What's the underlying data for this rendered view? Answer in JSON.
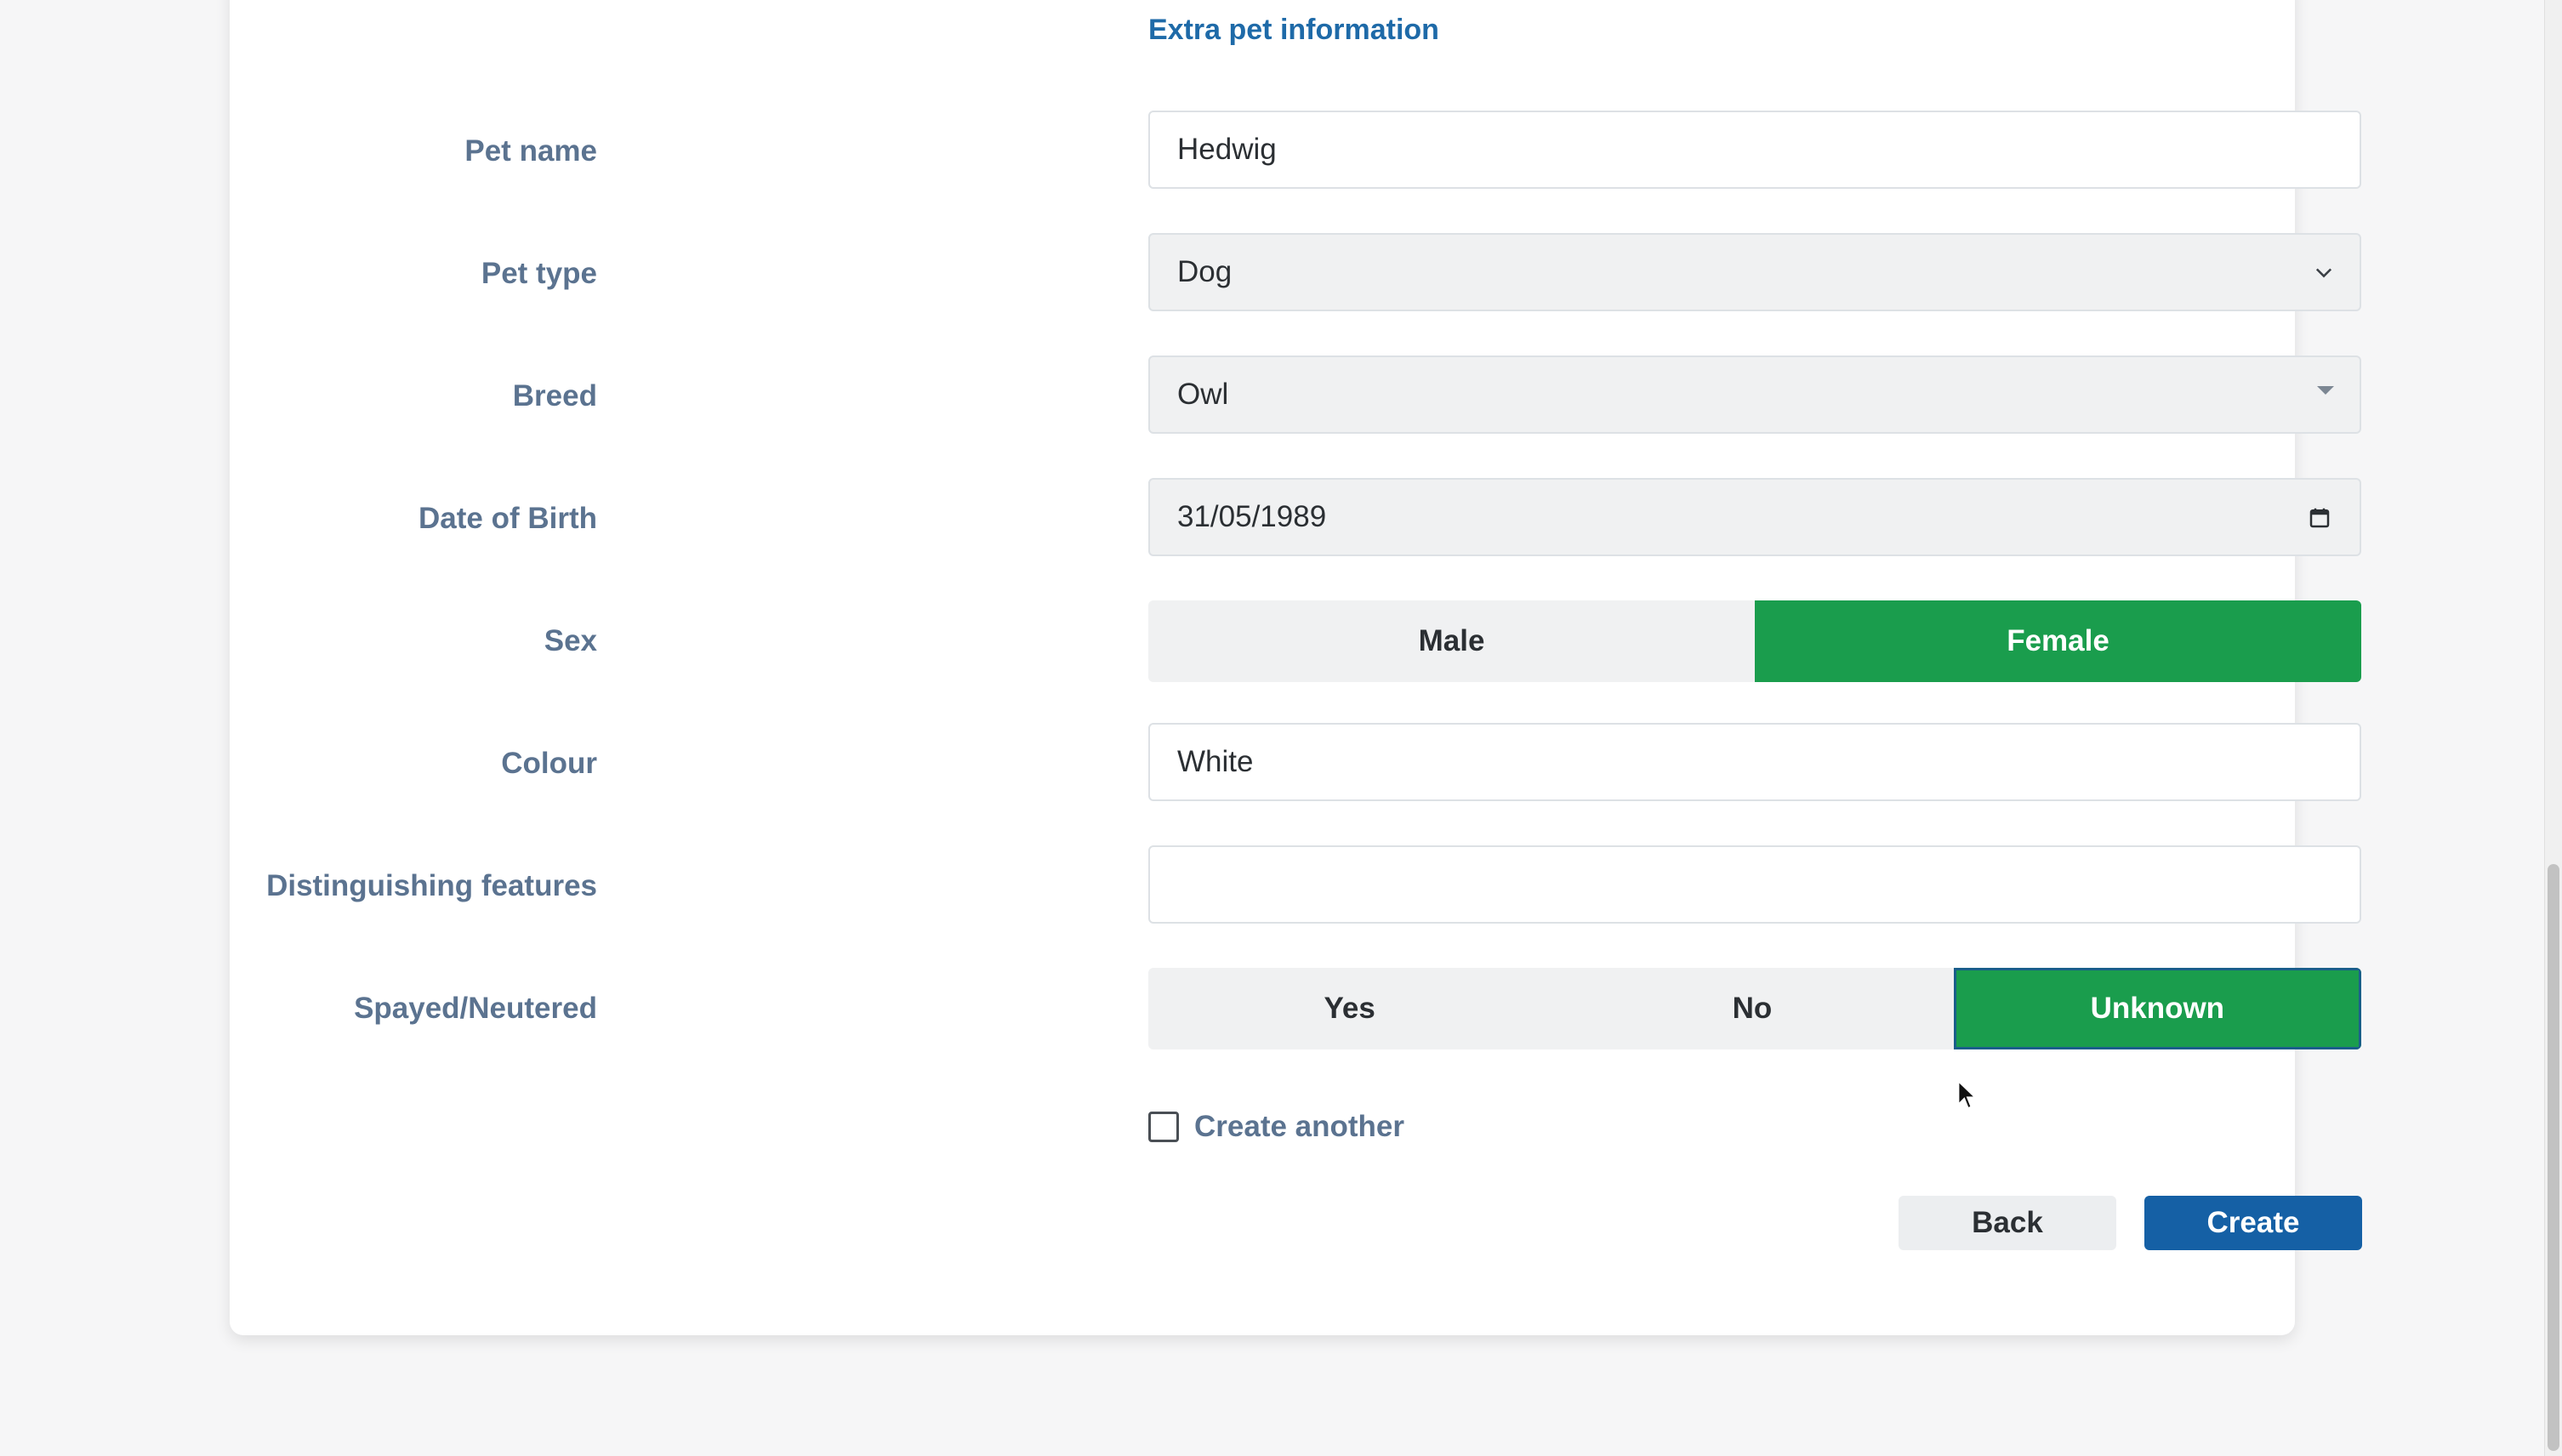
{
  "section": {
    "title": "Extra pet information"
  },
  "form": {
    "pet_name": {
      "label": "Pet name",
      "value": "Hedwig"
    },
    "pet_type": {
      "label": "Pet type",
      "value": "Dog"
    },
    "breed": {
      "label": "Breed",
      "value": "Owl"
    },
    "dob": {
      "label": "Date of Birth",
      "value": "31/05/1989"
    },
    "sex": {
      "label": "Sex",
      "options": [
        "Male",
        "Female"
      ],
      "selected": "Female"
    },
    "colour": {
      "label": "Colour",
      "value": "White"
    },
    "features": {
      "label": "Distinguishing features",
      "value": ""
    },
    "spayed": {
      "label": "Spayed/Neutered",
      "options": [
        "Yes",
        "No",
        "Unknown"
      ],
      "selected": "Unknown"
    }
  },
  "create_another": {
    "label": "Create another",
    "checked": false
  },
  "actions": {
    "back": "Back",
    "create": "Create"
  },
  "colors": {
    "accent": "#1a9d4d",
    "primary": "#1560a5",
    "label": "#5b7390",
    "link": "#1e6aa8"
  }
}
